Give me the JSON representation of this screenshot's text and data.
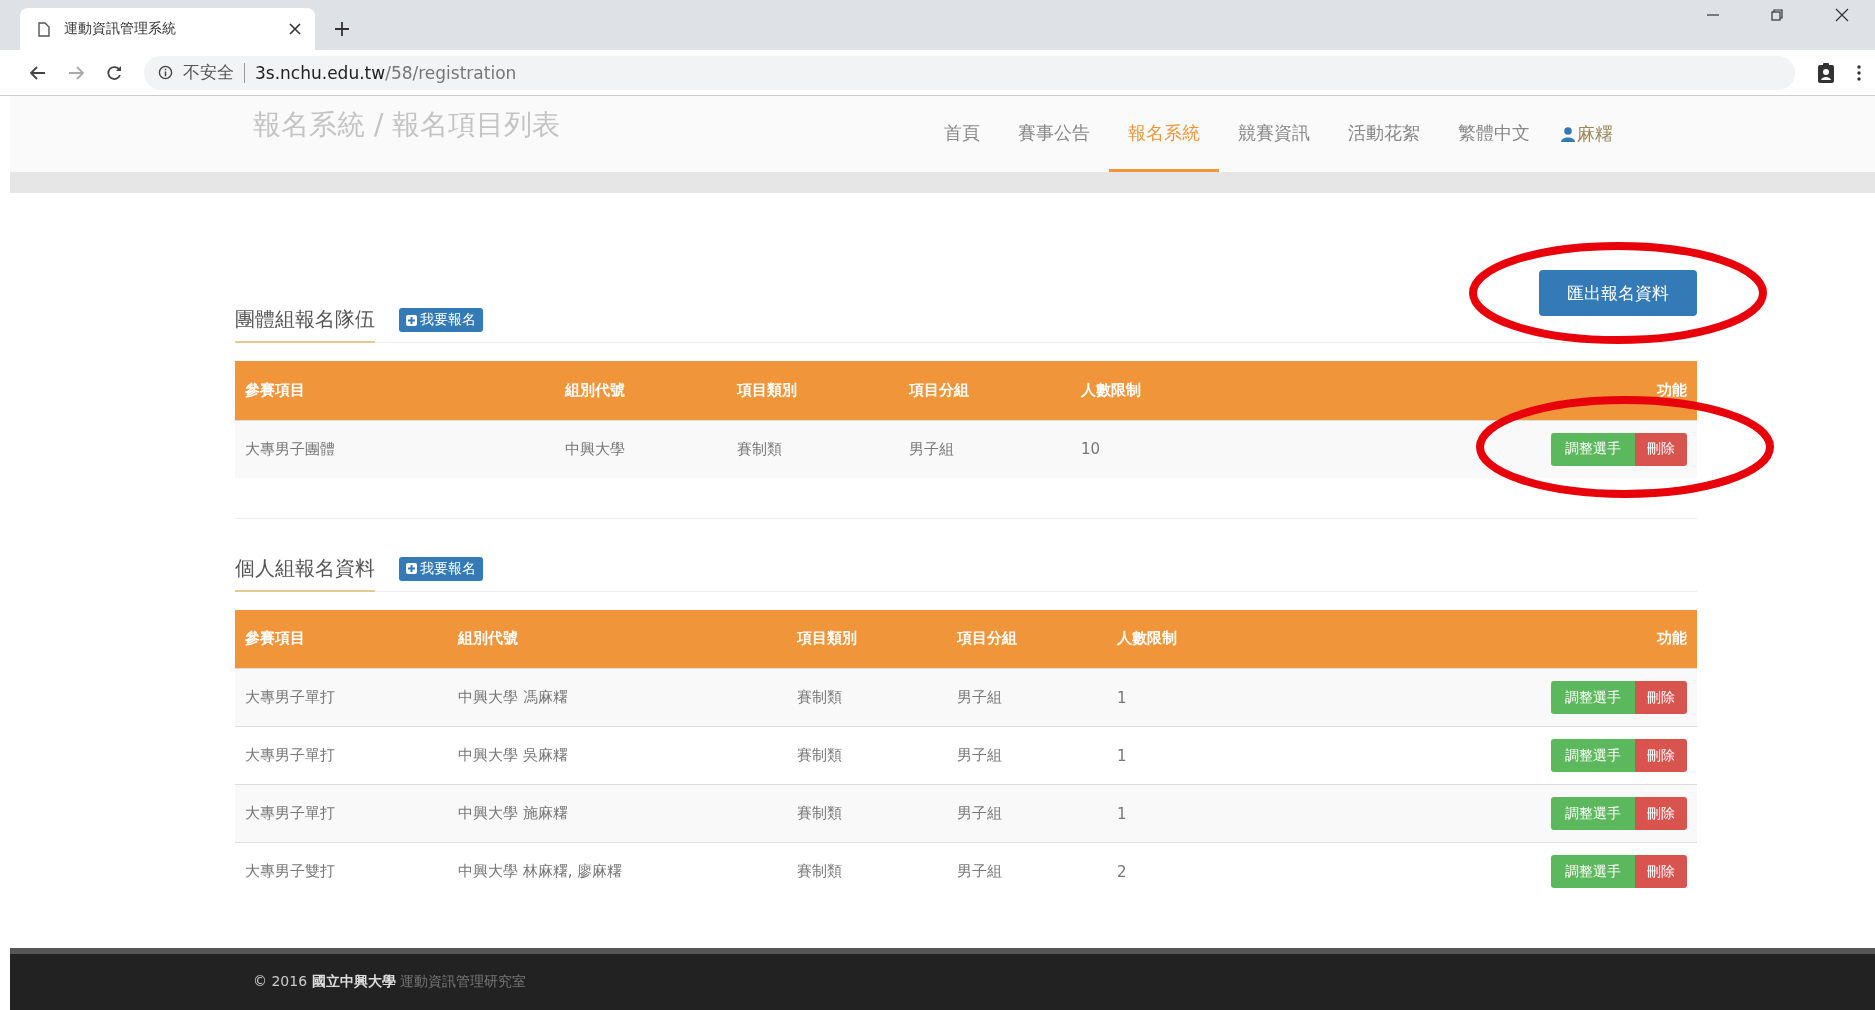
{
  "browser": {
    "tab_title": "運動資訊管理系統",
    "security": "不安全",
    "url_host": "3s.nchu.edu.tw",
    "url_path": "/58/registration"
  },
  "page_heading": "報名系統 / 報名項目列表",
  "nav": [
    {
      "label": "首頁",
      "selected": false
    },
    {
      "label": "賽事公告",
      "selected": false
    },
    {
      "label": "報名系統",
      "selected": true
    },
    {
      "label": "競賽資訊",
      "selected": false
    },
    {
      "label": "活動花絮",
      "selected": false
    },
    {
      "label": "繁體中文",
      "selected": false
    }
  ],
  "user": {
    "name": "麻糬"
  },
  "export_button": {
    "label": "匯出報名資料",
    "circled": true
  },
  "sections": [
    {
      "title": "團體組報名隊伍",
      "add_label": "我要報名",
      "columns": [
        "參賽項目",
        "組別代號",
        "項目類別",
        "項目分組",
        "人數限制",
        "功能"
      ],
      "rows": [
        {
          "cells": [
            "大專男子團體",
            "中興大學",
            "賽制類",
            "男子組",
            "10"
          ],
          "edit": "調整選手",
          "delete": "刪除",
          "circled": true
        }
      ]
    },
    {
      "title": "個人組報名資料",
      "add_label": "我要報名",
      "columns": [
        "參賽項目",
        "組別代號",
        "項目類別",
        "項目分組",
        "人數限制",
        "功能"
      ],
      "rows": [
        {
          "cells": [
            "大專男子單打",
            "中興大學 馮麻糬",
            "賽制類",
            "男子組",
            "1"
          ],
          "edit": "調整選手",
          "delete": "刪除",
          "circled": false
        },
        {
          "cells": [
            "大專男子單打",
            "中興大學 吳麻糬",
            "賽制類",
            "男子組",
            "1"
          ],
          "edit": "調整選手",
          "delete": "刪除",
          "circled": false
        },
        {
          "cells": [
            "大專男子單打",
            "中興大學 施麻糬",
            "賽制類",
            "男子組",
            "1"
          ],
          "edit": "調整選手",
          "delete": "刪除",
          "circled": false
        },
        {
          "cells": [
            "大專男子雙打",
            "中興大學 林麻糬, 廖麻糬",
            "賽制類",
            "男子組",
            "2"
          ],
          "edit": "調整選手",
          "delete": "刪除",
          "circled": false
        }
      ]
    }
  ],
  "footer": {
    "copyright": "© 2016",
    "org": "國立中興大學",
    "lab": "運動資訊管理研究室"
  }
}
